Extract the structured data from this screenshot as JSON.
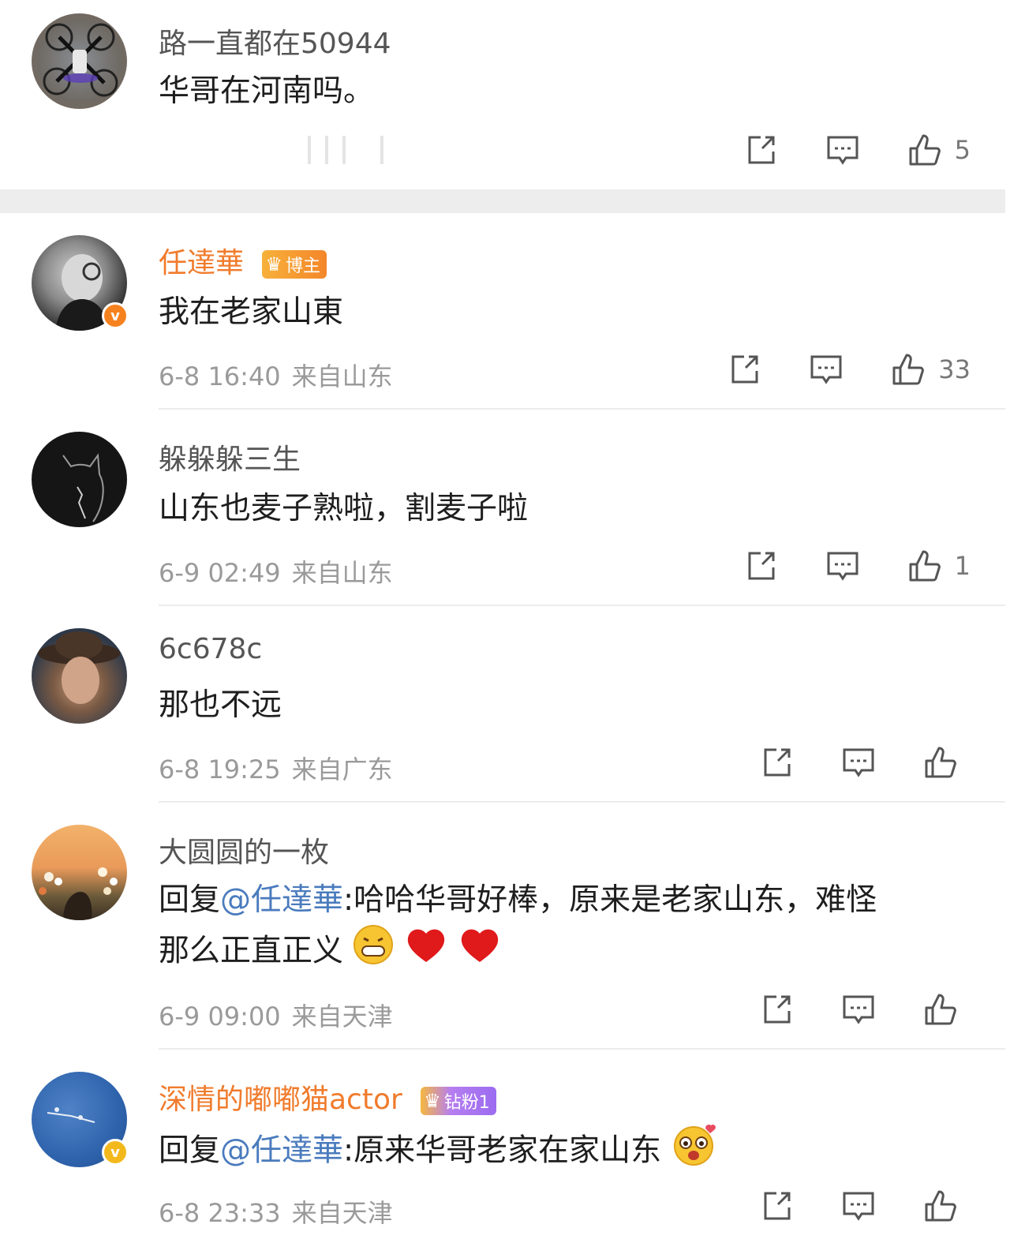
{
  "comments": [
    {
      "user": "路一直都在50944",
      "text": "华哥在河南吗。",
      "likes": "5"
    },
    {
      "user": "任達華",
      "badge": "博主",
      "text": "我在老家山東",
      "date": "6-8 16:40",
      "location": "来自山东",
      "likes": "33"
    },
    {
      "user": "躲躲躲三生",
      "text": "山东也麦子熟啦，割麦子啦",
      "date": "6-9 02:49",
      "location": "来自山东",
      "likes": "1"
    },
    {
      "user": "6c678c",
      "text": "那也不远",
      "date": "6-8 19:25",
      "location": "来自广东",
      "likes": ""
    },
    {
      "user": "大圆圆的一枚",
      "reply_prefix": "回复",
      "mention": "@任達華",
      "text_line1": ":哈哈华哥好棒，原来是老家山东，难怪",
      "text_line2": "那么正直正义",
      "date": "6-9 09:00",
      "location": "来自天津",
      "likes": ""
    },
    {
      "user": "深情的嘟嘟猫actor",
      "badge": "钻粉1",
      "reply_prefix": "回复",
      "mention": "@任達華",
      "text": ":原来华哥老家在家山东",
      "date": "6-8 23:33",
      "location": "来自天津",
      "likes": ""
    }
  ],
  "icons": {
    "share": "share-icon",
    "comment": "comment-icon",
    "like": "thumbs-up-icon"
  },
  "colors": {
    "vip_name": "#f07b2c",
    "mention": "#4a7bbd",
    "meta": "#9a9a9a",
    "verified_orange": "#f5821f",
    "verified_gold": "#f3b91c",
    "badge_orange": "#f39a2e",
    "badge_purple": "#b67ef0"
  }
}
